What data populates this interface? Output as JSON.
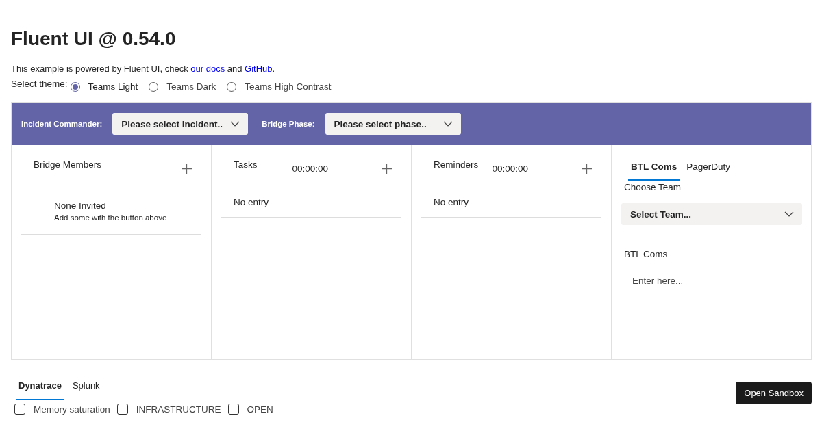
{
  "title": "Fluent UI @ 0.54.0",
  "intro": [
    {
      "kind": "text",
      "text": "This example is powered by Fluent UI, check "
    },
    {
      "kind": "link",
      "text": "our docs"
    },
    {
      "kind": "text",
      "text": " and "
    },
    {
      "kind": "link",
      "text": "GitHub"
    },
    {
      "kind": "text",
      "text": "."
    }
  ],
  "theme": {
    "label": "Select theme:",
    "options": [
      {
        "label": "Teams Light",
        "selected": true
      },
      {
        "label": "Teams Dark",
        "selected": false
      },
      {
        "label": "Teams High Contrast",
        "selected": false
      }
    ]
  },
  "header": [
    {
      "label": "Incident Commander:",
      "value": "Please select incident.."
    },
    {
      "label": "Bridge Phase:",
      "value": "Please select phase.."
    }
  ],
  "panels": [
    {
      "title": "Bridge Members",
      "empty": "None Invited",
      "hint": "Add some with the button above"
    },
    {
      "title": "Tasks",
      "timer": "00:00:00",
      "empty": "No entry"
    },
    {
      "title": "Reminders",
      "timer": "00:00:00",
      "empty": "No entry"
    }
  ],
  "side": {
    "tabs": [
      {
        "label": "BTL Coms",
        "selected": true
      },
      {
        "label": "PagerDuty",
        "selected": false
      }
    ],
    "team_label": "Choose Team",
    "team_value": "Select Team...",
    "coms_label": "BTL Coms",
    "coms_placeholder": "Enter here..."
  },
  "bottom_tabs": [
    {
      "label": "Dynatrace",
      "selected": true
    },
    {
      "label": "Splunk",
      "selected": false
    }
  ],
  "filters": [
    {
      "label": "Memory saturation",
      "checked": false
    },
    {
      "label": "INFRASTRUCTURE",
      "checked": false
    },
    {
      "label": "OPEN",
      "checked": false
    }
  ],
  "sandbox_button": "Open Sandbox"
}
